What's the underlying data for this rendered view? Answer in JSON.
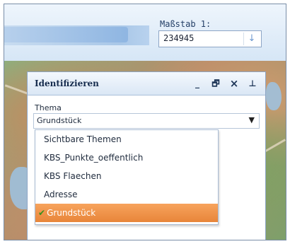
{
  "scale": {
    "label": "Maßstab 1:",
    "value": "234945",
    "apply_icon": "down-arrow-icon"
  },
  "panel": {
    "title": "Identifizieren",
    "controls": {
      "minimize": "_",
      "restore": "🗗",
      "close": "×",
      "pin": "⊥"
    },
    "field_label": "Thema",
    "selected_value": "Grundstück",
    "options": [
      {
        "label": "Sichtbare Themen",
        "selected": false
      },
      {
        "label": "KBS_Punkte_oeffentlich",
        "selected": false
      },
      {
        "label": "KBS Flaechen",
        "selected": false
      },
      {
        "label": "Adresse",
        "selected": false
      },
      {
        "label": "Grundstück",
        "selected": true
      }
    ]
  },
  "colors": {
    "accent_orange": "#e8853a",
    "check_green": "#3a8f1e",
    "header_blue": "#dae7f5"
  }
}
